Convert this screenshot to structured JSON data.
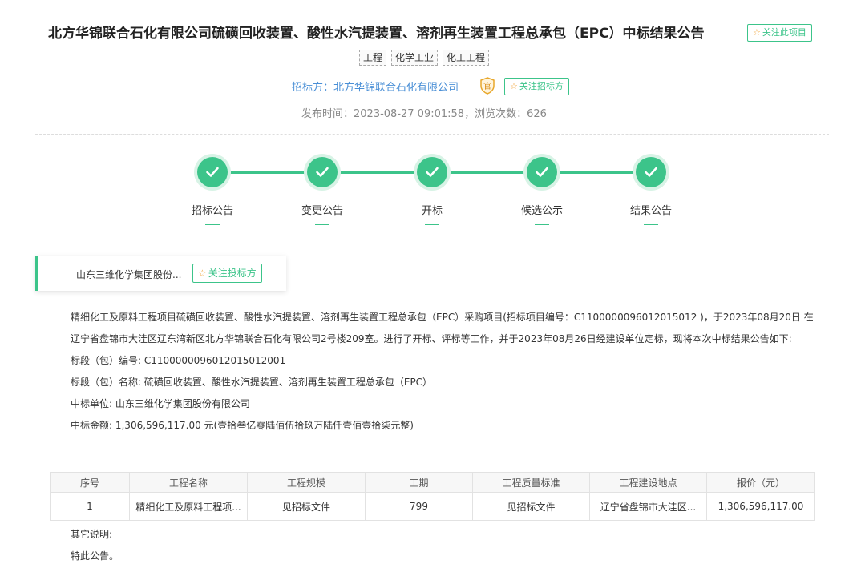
{
  "header": {
    "title": "北方华锦联合石化有限公司硫磺回收装置、酸性水汽提装置、溶剂再生装置工程总承包（EPC）中标结果公告",
    "follow_project_label": "关注此项目",
    "tags": [
      "工程",
      "化学工业",
      "化工工程"
    ],
    "tenderer_label": "招标方：",
    "tenderer_name": "北方华锦联合石化有限公司",
    "tenderer_badge": "官",
    "follow_tenderer_label": "关注招标方",
    "meta": "发布时间：2023-08-27 09:01:58，浏览次数：626"
  },
  "steps": [
    {
      "label": "招标公告"
    },
    {
      "label": "变更公告"
    },
    {
      "label": "开标"
    },
    {
      "label": "候选公示"
    },
    {
      "label": "结果公告"
    }
  ],
  "winner_card": {
    "name": "山东三维化学集团股份...",
    "follow_label": "关注投标方"
  },
  "body": {
    "paragraph": "精细化工及原料工程项目硫磺回收装置、酸性水汽提装置、溶剂再生装置工程总承包（EPC）采购项目(招标项目编号：C1100000096012015012 )，于2023年08月20日 在辽宁省盘锦市大洼区辽东湾新区北方华锦联合石化有限公司2号楼209室。进行了开标、评标等工作，并于2023年08月26日经建设单位定标，现将本次中标结果公告如下:",
    "lot_no": "标段（包）编号: C1100000096012015012001",
    "lot_name": "标段（包）名称: 硫磺回收装置、酸性水汽提装置、溶剂再生装置工程总承包（EPC）",
    "winner": "中标单位: 山东三维化学集团股份有限公司",
    "amount": "中标金额: 1,306,596,117.00 元(壹拾叁亿零陆佰伍拾玖万陆仟壹佰壹拾柒元整)"
  },
  "table": {
    "headers": [
      "序号",
      "工程名称",
      "工程规模",
      "工期",
      "工程质量标准",
      "工程建设地点",
      "报价（元）"
    ],
    "rows": [
      [
        "1",
        "精细化工及原料工程项...",
        "见招标文件",
        "799",
        "见招标文件",
        "辽宁省盘锦市大洼区...",
        "1,306,596,117.00"
      ]
    ]
  },
  "footer": {
    "other_notes": "其它说明:",
    "closing": "特此公告。"
  },
  "colors": {
    "accent": "#3cc48a",
    "link": "#4a8fd6",
    "star": "#f0a030"
  }
}
